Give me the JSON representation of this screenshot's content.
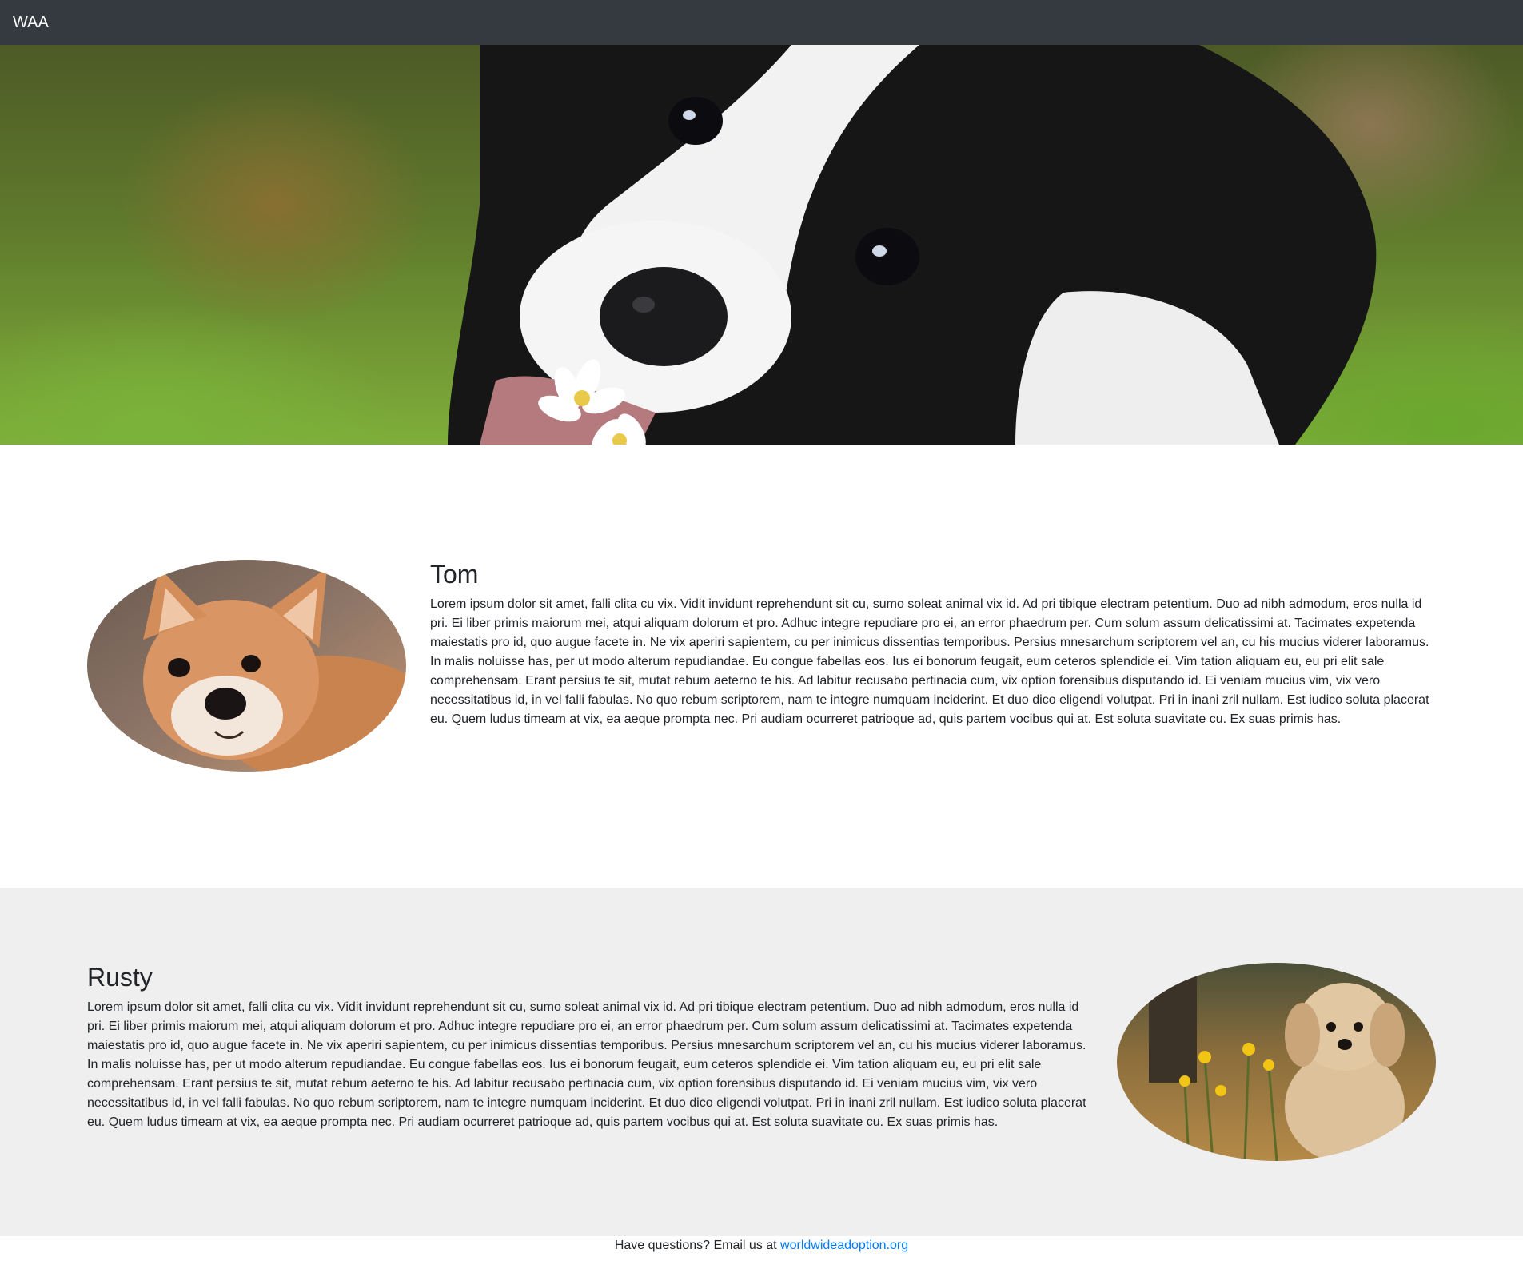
{
  "navbar": {
    "brand": "WAA"
  },
  "hero": {
    "image_icon": "dog-photo"
  },
  "pets": [
    {
      "name": "Tom",
      "image_icon": "puppy-photo",
      "description": "Lorem ipsum dolor sit amet, falli clita cu vix. Vidit invidunt reprehendunt sit cu, sumo soleat animal vix id. Ad pri tibique electram petentium. Duo ad nibh admodum, eros nulla id pri. Ei liber primis maiorum mei, atqui aliquam dolorum et pro. Adhuc integre repudiare pro ei, an error phaedrum per. Cum solum assum delicatissimi at. Tacimates expetenda maiestatis pro id, quo augue facete in. Ne vix aperiri sapientem, cu per inimicus dissentias temporibus. Persius mnesarchum scriptorem vel an, cu his mucius viderer laboramus. In malis noluisse has, per ut modo alterum repudiandae. Eu congue fabellas eos. Ius ei bonorum feugait, eum ceteros splendide ei. Vim tation aliquam eu, eu pri elit sale comprehensam. Erant persius te sit, mutat rebum aeterno te his. Ad labitur recusabo pertinacia cum, vix option forensibus disputando id. Ei veniam mucius vim, vix vero necessitatibus id, in vel falli fabulas. No quo rebum scriptorem, nam te integre numquam inciderint. Et duo dico eligendi volutpat. Pri in inani zril nullam. Est iudico soluta placerat eu. Quem ludus timeam at vix, ea aeque prompta nec. Pri audiam ocurreret patrioque ad, quis partem vocibus qui at. Est soluta suavitate cu. Ex suas primis has."
    },
    {
      "name": "Rusty",
      "image_icon": "puppy-photo",
      "description": "Lorem ipsum dolor sit amet, falli clita cu vix. Vidit invidunt reprehendunt sit cu, sumo soleat animal vix id. Ad pri tibique electram petentium. Duo ad nibh admodum, eros nulla id pri. Ei liber primis maiorum mei, atqui aliquam dolorum et pro. Adhuc integre repudiare pro ei, an error phaedrum per. Cum solum assum delicatissimi at. Tacimates expetenda maiestatis pro id, quo augue facete in. Ne vix aperiri sapientem, cu per inimicus dissentias temporibus. Persius mnesarchum scriptorem vel an, cu his mucius viderer laboramus. In malis noluisse has, per ut modo alterum repudiandae. Eu congue fabellas eos. Ius ei bonorum feugait, eum ceteros splendide ei. Vim tation aliquam eu, eu pri elit sale comprehensam. Erant persius te sit, mutat rebum aeterno te his. Ad labitur recusabo pertinacia cum, vix option forensibus disputando id. Ei veniam mucius vim, vix vero necessitatibus id, in vel falli fabulas. No quo rebum scriptorem, nam te integre numquam inciderint. Et duo dico eligendi volutpat. Pri in inani zril nullam. Est iudico soluta placerat eu. Quem ludus timeam at vix, ea aeque prompta nec. Pri audiam ocurreret patrioque ad, quis partem vocibus qui at. Est soluta suavitate cu. Ex suas primis has."
    }
  ],
  "footer": {
    "text": "Have questions? Email us at",
    "link_text": "worldwideadoption.org"
  },
  "colors": {
    "navbar_bg": "#343a40",
    "section_alt_bg": "#efefef",
    "link": "#007bff"
  }
}
